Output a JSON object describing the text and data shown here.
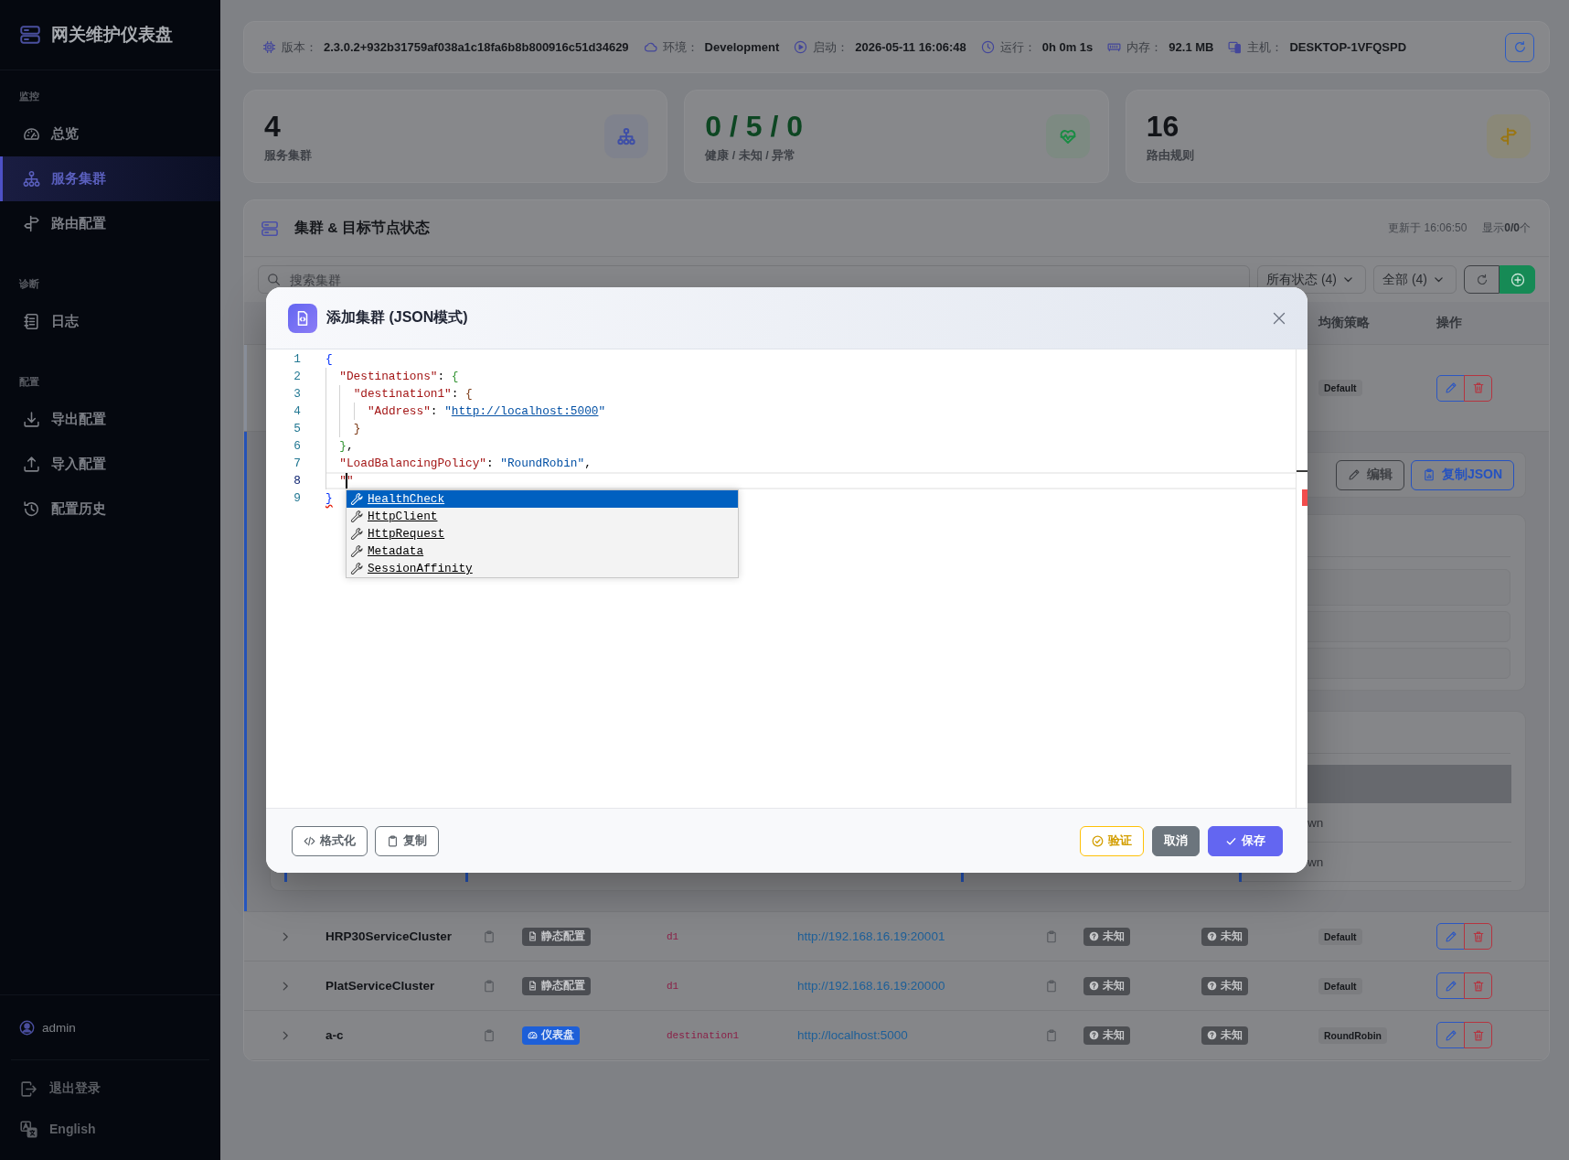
{
  "sidebar": {
    "title": "网关维护仪表盘",
    "sections": [
      {
        "label": "监控",
        "items": [
          {
            "label": "总览",
            "selected": false
          },
          {
            "label": "服务集群",
            "selected": true
          },
          {
            "label": "路由配置",
            "selected": false
          }
        ]
      },
      {
        "label": "诊断",
        "items": [
          {
            "label": "日志",
            "selected": false
          }
        ]
      },
      {
        "label": "配置",
        "items": [
          {
            "label": "导出配置",
            "selected": false
          },
          {
            "label": "导入配置",
            "selected": false
          },
          {
            "label": "配置历史",
            "selected": false
          }
        ]
      }
    ],
    "user": "admin",
    "footer_items": [
      "退出登录",
      "English"
    ]
  },
  "info_bar": {
    "items": [
      {
        "label": "版本：",
        "value": "2.3.0.2+932b31759af038a1c18fa6b8b800916c51d34629"
      },
      {
        "label": "环境：",
        "value": "Development"
      },
      {
        "label": "启动：",
        "value": "2026-05-11 16:06:48"
      },
      {
        "label": "运行：",
        "value": "0h 0m 1s"
      },
      {
        "label": "内存：",
        "value": "92.1 MB"
      },
      {
        "label": "主机：",
        "value": "DESKTOP-1VFQSPD"
      }
    ]
  },
  "stats": [
    {
      "value": "4",
      "label": "服务集群",
      "kind": "count"
    },
    {
      "value": "0 / 5 / 0",
      "label": "健康 / 未知 / 异常",
      "kind": "health"
    },
    {
      "value": "16",
      "label": "路由规则",
      "kind": "count"
    }
  ],
  "clusters": {
    "title": "集群 & 目标节点状态",
    "updated": "更新于 16:06:50",
    "shown": "显示**0/0**个",
    "search": {
      "placeholder": "搜索集群"
    },
    "filters": [
      "所有状态 (4)",
      "全部 (4)"
    ],
    "columns": [
      "均衡策略",
      "操作"
    ],
    "rows": [
      {
        "expanded": true,
        "policy": "Default",
        "details": {
          "buttons": [
            "编辑",
            "复制JSON"
          ],
          "table_cells": [
            "wn",
            "wn"
          ]
        }
      },
      {
        "expanded": false,
        "name": "HRP30ServiceCluster",
        "source": {
          "label": "静态配置",
          "kind": "static"
        },
        "destination": "d1",
        "address": "http://192.168.16.19:20001",
        "health": [
          {
            "label": "未知",
            "kind": "unknown"
          },
          {
            "label": "未知",
            "kind": "unknown"
          }
        ],
        "policy": "Default"
      },
      {
        "expanded": false,
        "name": "PlatServiceCluster",
        "source": {
          "label": "静态配置",
          "kind": "static"
        },
        "destination": "d1",
        "address": "http://192.168.16.19:20000",
        "health": [
          {
            "label": "未知",
            "kind": "unknown"
          },
          {
            "label": "未知",
            "kind": "unknown"
          }
        ],
        "policy": "Default"
      },
      {
        "expanded": false,
        "name": "a-c",
        "source": {
          "label": "仪表盘",
          "kind": "dashboard"
        },
        "destination": "destination1",
        "address": "http://localhost:5000",
        "health": [
          {
            "label": "未知",
            "kind": "unknown"
          },
          {
            "label": "未知",
            "kind": "unknown"
          }
        ],
        "policy": "RoundRobin"
      }
    ]
  },
  "modal": {
    "title": "添加集群 (JSON模式)",
    "editor": {
      "lines": [
        {
          "number": "1",
          "text": "{",
          "current": false,
          "error": false
        },
        {
          "number": "2",
          "text": "  \"Destinations\": {",
          "current": false,
          "error": false
        },
        {
          "number": "3",
          "text": "    \"destination1\": {",
          "current": false,
          "error": false
        },
        {
          "number": "4",
          "text": "      \"Address\": \"http://localhost:5000\"",
          "current": false,
          "error": false
        },
        {
          "number": "5",
          "text": "    }",
          "current": false,
          "error": false
        },
        {
          "number": "6",
          "text": "  },",
          "current": false,
          "error": false
        },
        {
          "number": "7",
          "text": "  \"LoadBalancingPolicy\": \"RoundRobin\",",
          "current": false,
          "error": false
        },
        {
          "number": "8",
          "text": "  \"",
          "text_after_cursor": "\"",
          "current": true,
          "error": false
        },
        {
          "number": "9",
          "text": "}",
          "current": false,
          "error": true
        }
      ]
    },
    "suggestions": [
      {
        "label": "HealthCheck",
        "selected": true
      },
      {
        "label": "HttpClient",
        "selected": false
      },
      {
        "label": "HttpRequest",
        "selected": false
      },
      {
        "label": "Metadata",
        "selected": false
      },
      {
        "label": "SessionAffinity",
        "selected": false
      }
    ],
    "footer_left": [
      "格式化",
      "复制"
    ],
    "footer_right": [
      {
        "label": "验证",
        "kind": "warning"
      },
      {
        "label": "取消",
        "kind": "secondary"
      },
      {
        "label": "保存",
        "kind": "primary"
      }
    ]
  }
}
